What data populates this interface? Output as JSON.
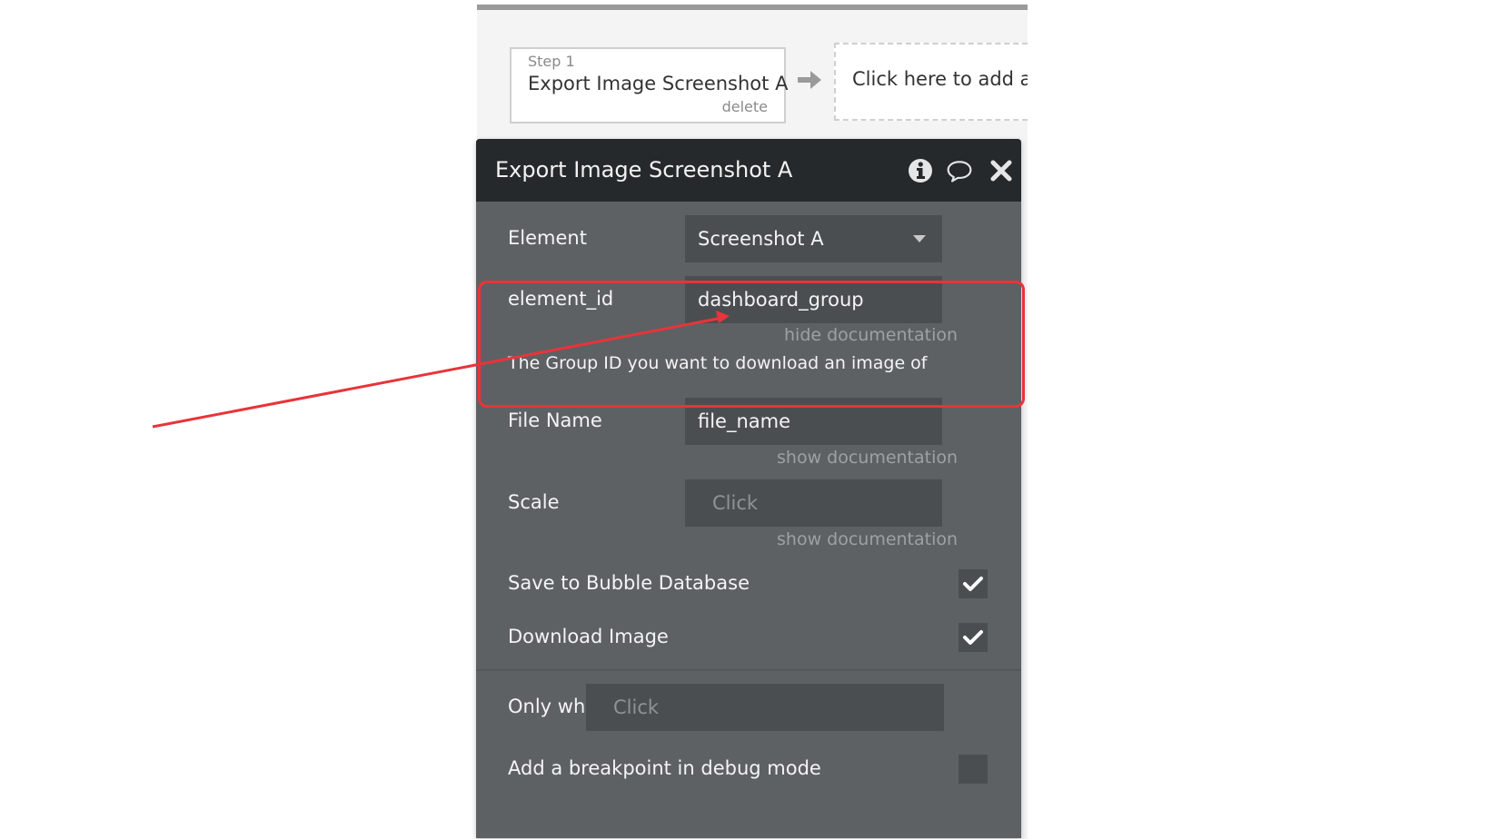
{
  "workflow": {
    "step_label": "Step 1",
    "step_title": "Export Image Screenshot A",
    "step_delete": "delete",
    "add_action": "Click here to add an"
  },
  "panel": {
    "title": "Export Image Screenshot A",
    "rows": {
      "element": {
        "label": "Element",
        "value": "Screenshot A"
      },
      "element_id": {
        "label": "element_id",
        "value": "dashboard_group",
        "doc_link": "hide documentation",
        "doc_text": "The Group ID you want to download an image of"
      },
      "file_name": {
        "label": "File Name",
        "value": "file_name",
        "doc_link": "show documentation"
      },
      "scale": {
        "label": "Scale",
        "placeholder": "Click",
        "doc_link": "show documentation"
      },
      "save_db": {
        "label": "Save to Bubble Database",
        "checked": true
      },
      "download": {
        "label": "Download Image",
        "checked": true
      },
      "only_when": {
        "label": "Only when",
        "placeholder": "Click"
      },
      "breakpoint": {
        "label": "Add a breakpoint in debug mode",
        "checked": false
      }
    }
  },
  "icons": {
    "info": "info-icon",
    "comment": "comment-icon",
    "close": "close-icon",
    "arrow": "arrow-right-icon",
    "caret": "chevron-down-icon",
    "check": "checkmark-icon"
  },
  "colors": {
    "panel_bg": "#5d6164",
    "header_bg": "#26292b",
    "field_bg": "#4b4e51",
    "annotation_red": "#e8343a"
  }
}
